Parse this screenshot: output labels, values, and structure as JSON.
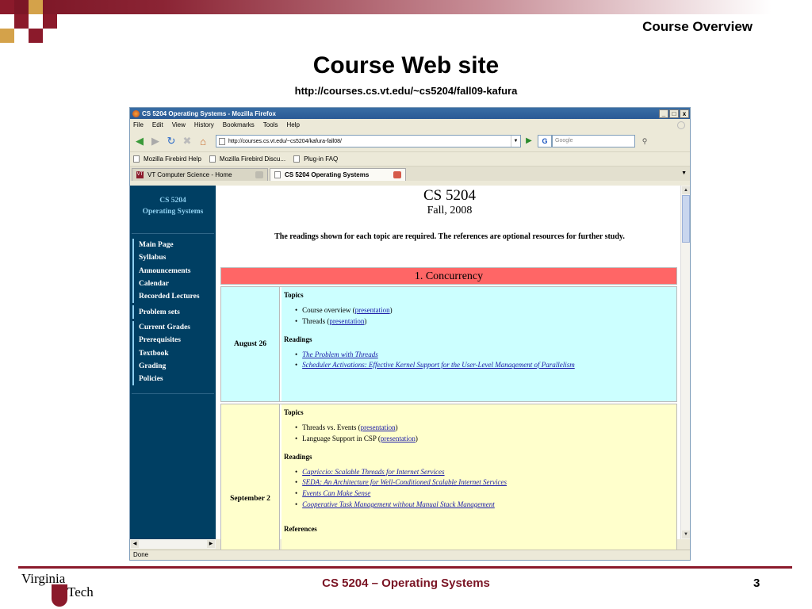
{
  "slide": {
    "header": "Course Overview",
    "title": "Course Web site",
    "url": "http://courses.cs.vt.edu/~cs5204/fall09-kafura",
    "footer_title": "CS 5204 – Operating Systems",
    "page_number": "3",
    "logo_text_top": "Virginia",
    "logo_text_bottom": "Tech",
    "accent_color": "#8b1a2b"
  },
  "browser": {
    "window_title": "CS 5204 Operating Systems - Mozilla Firefox",
    "window_buttons": [
      "_",
      "□",
      "x"
    ],
    "menu": [
      "File",
      "Edit",
      "View",
      "History",
      "Bookmarks",
      "Tools",
      "Help"
    ],
    "address": "http://courses.cs.vt.edu/~cs5204/kafura-fall08/",
    "search_placeholder": "Google",
    "search_engine_icon": "G",
    "bookmarks": [
      "Mozilla Firebird Help",
      "Mozilla Firebird Discu...",
      "Plug-in FAQ"
    ],
    "tabs": [
      {
        "label": "VT Computer Science - Home",
        "active": false
      },
      {
        "label": "CS 5204 Operating Systems",
        "active": true
      }
    ],
    "status": "Done"
  },
  "sidebar": {
    "title_line1": "CS 5204",
    "title_line2": "Operating Systems",
    "items": [
      "Main Page",
      "Syllabus",
      "Announcements",
      "Calendar",
      "Recorded Lectures",
      "Problem sets",
      "Current Grades",
      "Prerequisites",
      "Textbook",
      "Grading",
      "Policies"
    ]
  },
  "page": {
    "title": "CS 5204",
    "subtitle": "Fall, 2008",
    "note": "The readings shown for each topic are required. The references are optional resources for further study.",
    "section": "1. Concurrency",
    "rows": [
      {
        "date": "August 26",
        "topics_label": "Topics",
        "topics": [
          {
            "text": "Course overview (",
            "link": "presentation",
            "tail": ")"
          },
          {
            "text": "Threads (",
            "link": "presentation",
            "tail": ")"
          }
        ],
        "readings_label": "Readings",
        "readings": [
          "The Problem with Threads",
          "Scheduler Activations: Effective Kernel Support for the User-Level Management of Parallelism"
        ]
      },
      {
        "date": "September 2",
        "topics_label": "Topics",
        "topics": [
          {
            "text": "Threads vs. Events (",
            "link": "presentation",
            "tail": ")"
          },
          {
            "text": "Language Support in CSP (",
            "link": "presentation",
            "tail": ")"
          }
        ],
        "readings_label": "Readings",
        "readings": [
          "Capriccio: Scalable Threads for Internet Services",
          "SEDA: An Architecture for Well-Conditioned Scalable Internet Services",
          "Events Can Make Sense",
          "Cooperative Task Management without Manual Stack Management"
        ],
        "references_label": "References"
      }
    ]
  }
}
